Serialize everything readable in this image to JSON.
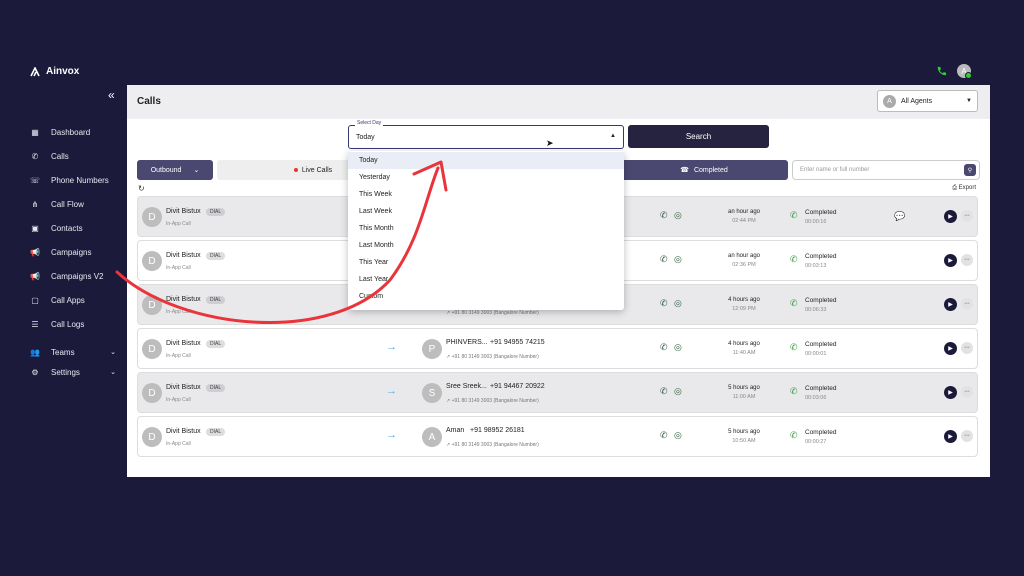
{
  "brand": {
    "name": "Ainvox"
  },
  "sidebar": {
    "collapse_icon": "double-chevron-left-icon",
    "items": [
      {
        "label": "Dashboard",
        "icon": "dashboard-icon"
      },
      {
        "label": "Calls",
        "icon": "phone-icon"
      },
      {
        "label": "Phone Numbers",
        "icon": "phone-outline-icon"
      },
      {
        "label": "Call Flow",
        "icon": "flow-icon"
      },
      {
        "label": "Contacts",
        "icon": "contacts-icon"
      },
      {
        "label": "Campaigns",
        "icon": "megaphone-icon"
      },
      {
        "label": "Campaigns V2",
        "icon": "megaphone-icon"
      },
      {
        "label": "Call Apps",
        "icon": "apps-icon"
      },
      {
        "label": "Call Logs",
        "icon": "logs-icon"
      },
      {
        "label": "Teams",
        "icon": "team-icon",
        "chevron": "⌄"
      },
      {
        "label": "Settings",
        "icon": "gear-icon",
        "chevron": "⌄"
      }
    ]
  },
  "topbar": {
    "avatar": "A"
  },
  "header": {
    "title": "Calls",
    "agents_avatar": "A",
    "agents_label": "All Agents"
  },
  "filter": {
    "select_label": "Select Day",
    "select_value": "Today",
    "search_button": "Search",
    "outbound": "Outbound",
    "live_calls": "Live Calls",
    "completed": "Completed",
    "number_placeholder": "Enter name or full number",
    "export": "Export"
  },
  "dropdown": {
    "options": [
      "Today",
      "Yesterday",
      "This Week",
      "Last Week",
      "This Month",
      "Last Month",
      "This Year",
      "Last Year",
      "Custom"
    ]
  },
  "calls": [
    {
      "agent": "Divit Bistux",
      "badge": "DIAL",
      "agent_sub": "In-App Call",
      "contact_initial": "",
      "contact_name": "",
      "contact_number": "",
      "contact_sub": "",
      "time_ago": "an hour ago",
      "time": "02:44 PM",
      "status": "Completed",
      "duration": "00:00:16",
      "has_comment": true
    },
    {
      "agent": "Divit Bistux",
      "badge": "DIAL",
      "agent_sub": "In-App Call",
      "contact_initial": "",
      "contact_name": "",
      "contact_number": "",
      "contact_sub": "",
      "time_ago": "an hour ago",
      "time": "02:36 PM",
      "status": "Completed",
      "duration": "00:03:13",
      "has_comment": false
    },
    {
      "agent": "Divit Bistux",
      "badge": "DIAL",
      "agent_sub": "In-App Call",
      "contact_initial": "",
      "contact_name": "",
      "contact_number": "",
      "contact_sub": "+91 80 3149 3003 (Bangalore Number)",
      "time_ago": "4 hours ago",
      "time": "12:09 PM",
      "status": "Completed",
      "duration": "00:06:33",
      "has_comment": false
    },
    {
      "agent": "Divit Bistux",
      "badge": "DIAL",
      "agent_sub": "In-App Call",
      "contact_initial": "P",
      "contact_name": "PHINVERS...",
      "contact_number": "+91 94955 74215",
      "contact_sub": "+91 80 3149 3003 (Bangalore Number)",
      "time_ago": "4 hours ago",
      "time": "11:40 AM",
      "status": "Completed",
      "duration": "00:00:01",
      "has_comment": false
    },
    {
      "agent": "Divit Bistux",
      "badge": "DIAL",
      "agent_sub": "In-App Call",
      "contact_initial": "S",
      "contact_name": "Sree Sreek...",
      "contact_number": "+91 94467 20922",
      "contact_sub": "+91 80 3149 3003 (Bangalore Number)",
      "time_ago": "5 hours ago",
      "time": "11:00 AM",
      "status": "Completed",
      "duration": "00:03:06",
      "has_comment": false
    },
    {
      "agent": "Divit Bistux",
      "badge": "DIAL",
      "agent_sub": "In-App Call",
      "contact_initial": "A",
      "contact_name": "Aman",
      "contact_number": "+91 98952 26181",
      "contact_sub": "+91 80 3149 3003 (Bangalore Number)",
      "time_ago": "5 hours ago",
      "time": "10:50 AM",
      "status": "Completed",
      "duration": "00:00:27",
      "has_comment": false
    }
  ]
}
